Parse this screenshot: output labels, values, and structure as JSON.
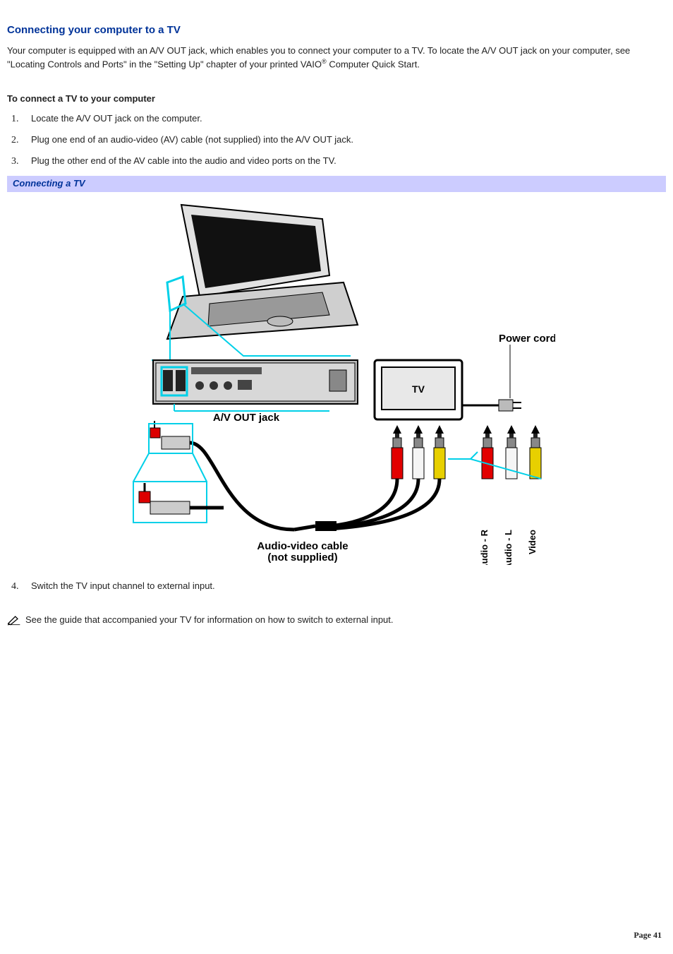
{
  "heading": "Connecting your computer to a TV",
  "intro_a": "Your computer is equipped with an A/V OUT jack, which enables you to connect your computer to a TV. To locate the A/V OUT jack on your computer, see \"Locating Controls and Ports\" in the \"Setting Up\" chapter of your printed VAIO",
  "trademark": "®",
  "intro_b": " Computer Quick Start.",
  "subheading": "To connect a TV to your computer",
  "steps_1to3": [
    {
      "n": "1.",
      "t": "Locate the A/V OUT jack on the computer."
    },
    {
      "n": "2.",
      "t": "Plug one end of an audio-video (AV) cable (not supplied) into the A/V OUT jack."
    },
    {
      "n": "3.",
      "t": "Plug the other end of the AV cable into the audio and video ports on the TV."
    }
  ],
  "figure_caption": "Connecting a TV",
  "labels": {
    "power_cord": "Power cord",
    "av_out_jack": "A/V OUT jack",
    "tv": "TV",
    "av_cable_l1": "Audio-video cable",
    "av_cable_l2": "(not supplied)",
    "audio_r": "Audio - R",
    "audio_l": "Audio - L",
    "video": "Video"
  },
  "step4": {
    "n": "4.",
    "t": "Switch the TV input channel to external input."
  },
  "note": "See the guide that accompanied your TV for information on how to switch to external input.",
  "page": "Page 41"
}
